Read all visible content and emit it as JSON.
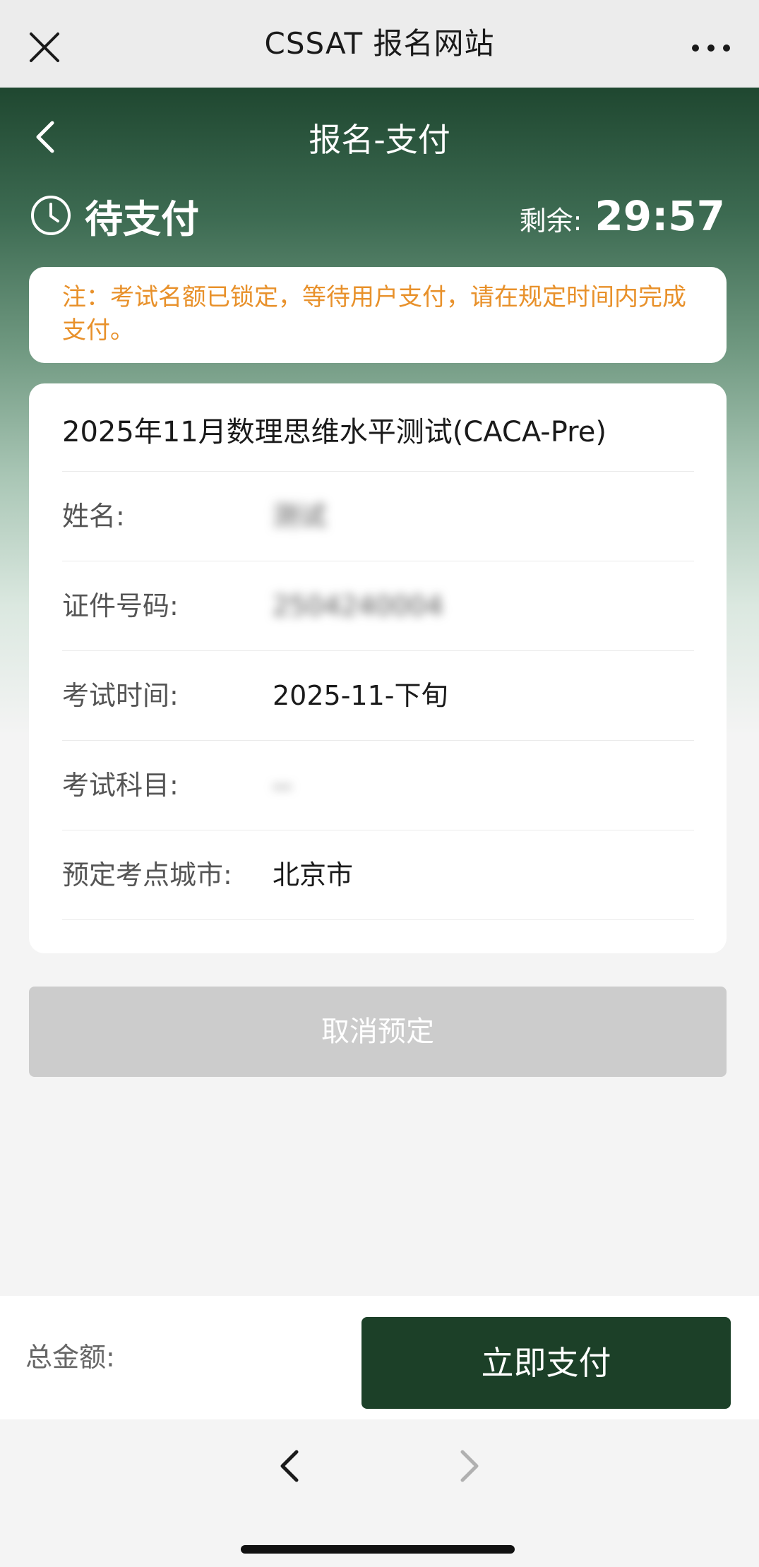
{
  "browser": {
    "site_title": "CSSAT 报名网站",
    "close_icon": "close-icon",
    "more_icon": "more-icon"
  },
  "header": {
    "title": "报名-支付",
    "back_icon": "chevron-left-icon"
  },
  "status": {
    "label": "待支付",
    "icon": "clock-icon",
    "remaining_label": "剩余:",
    "remaining_time": "29:57"
  },
  "notice": {
    "text": "注：考试名额已锁定，等待用户支付，请在规定时间内完成支付。",
    "color": "#e8912b"
  },
  "exam": {
    "title": "2025年11月数理思维水平测试(CACA-Pre)",
    "fields": [
      {
        "label": "姓名:",
        "value": "测试",
        "blurred": true
      },
      {
        "label": "证件号码:",
        "value": "2504240004",
        "blurred": true
      },
      {
        "label": "考试时间:",
        "value": "2025-11-下旬",
        "blurred": false
      },
      {
        "label": "考试科目:",
        "value": "--",
        "blurred": true
      },
      {
        "label": "预定考点城市:",
        "value": "北京市",
        "blurred": false
      }
    ]
  },
  "actions": {
    "cancel_label": "取消预定",
    "pay_label": "立即支付",
    "total_label": "总金额:"
  },
  "colors": {
    "brand_green": "#1c4028",
    "header_green": "#1f4730",
    "disabled_gray": "#cccccc"
  }
}
